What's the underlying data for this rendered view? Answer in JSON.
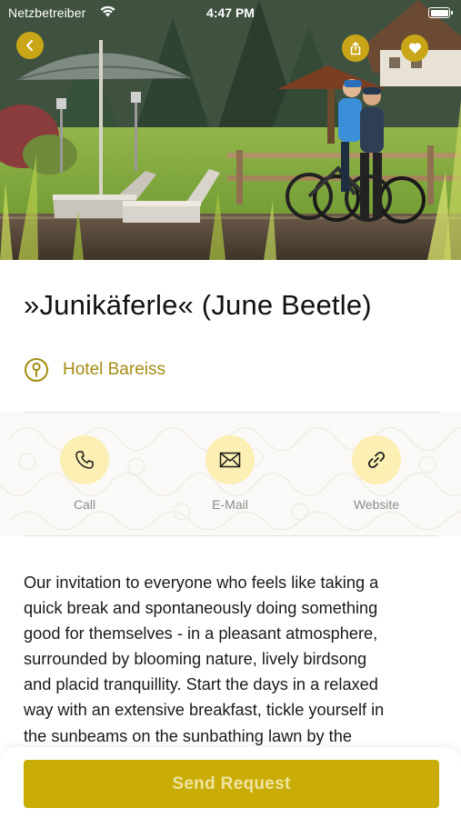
{
  "status_bar": {
    "carrier": "Netzbetreiber",
    "time": "4:47 PM"
  },
  "hero": {
    "image_subject": "outdoor-photo",
    "back_icon": "chevron-left-icon",
    "share_icon": "share-icon",
    "favorite_icon": "heart-icon"
  },
  "offer": {
    "title": "»Junikäferle« (June Beetle)",
    "location": "Hotel Bareiss"
  },
  "contact": {
    "items": [
      {
        "label": "Call",
        "icon": "phone-icon"
      },
      {
        "label": "E-Mail",
        "icon": "mail-icon"
      },
      {
        "label": "Website",
        "icon": "link-icon"
      }
    ]
  },
  "description": {
    "lines": [
      "Our invitation to everyone who feels like taking a",
      "quick break and spontaneously doing something",
      "good for themselves - in a pleasant atmosphere,",
      "surrounded by blooming nature, lively birdsong",
      "and placid tranquillity. Start the days in a relaxed",
      "way with an extensive breakfast, tickle yourself in",
      "the sunbeams on the sunbathing lawn by the"
    ]
  },
  "actions": {
    "send_label": "Send Request"
  },
  "colors": {
    "accent": "#c9ad06",
    "accent_text": "#a48c12",
    "icon_bg": "#fbefb3",
    "label_gray": "#8c8c8c"
  }
}
